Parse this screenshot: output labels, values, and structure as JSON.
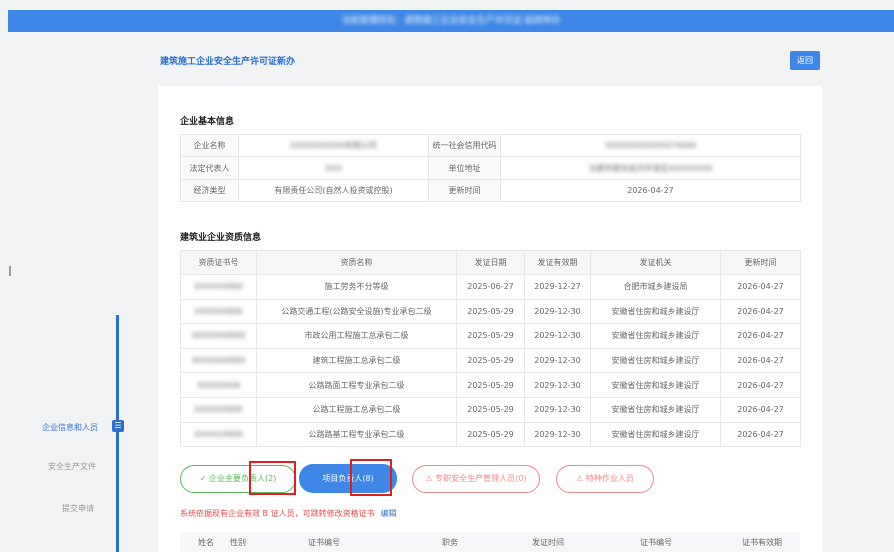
{
  "header": {
    "title": "当前管理所在：建筑施工企业安全生产许可证 延续申办"
  },
  "page": {
    "title": "建筑施工企业安全生产许可证新办",
    "back_label": "返回"
  },
  "sidebar": {
    "steps": [
      "企业信息和人员",
      "安全生产文件",
      "提交申请"
    ]
  },
  "basic_info": {
    "title": "企业基本信息",
    "rows": [
      {
        "k1": "企业名称",
        "v1": "XXXXXXXXXX有限公司",
        "k2": "统一社会信用代码",
        "v2": "XXXXXXXXXXXX74040"
      },
      {
        "k1": "法定代表人",
        "v1": "XXX",
        "k2": "单位地址",
        "v2": "合肥市肥东经济开发区XXXXXXXX"
      },
      {
        "k1": "经济类型",
        "v1": "有限责任公司(自然人投资或控股)",
        "k2": "更新时间",
        "v2": "2026-04-27"
      }
    ]
  },
  "qualification": {
    "title": "建筑业企业资质信息",
    "columns": [
      "资质证书号",
      "资质名称",
      "发证日期",
      "发证有效期",
      "发证机关",
      "更新时间"
    ],
    "rows": [
      [
        "XXXXXX900",
        "施工劳务不分等级",
        "2025-06-27",
        "2029-12-27",
        "合肥市城乡建设局",
        "2026-04-27"
      ],
      [
        "XXXXXX909",
        "公路交通工程(公路安全设施)专业承包二级",
        "2025-05-29",
        "2029-12-30",
        "安徽省住房和城乡建设厅",
        "2026-04-27"
      ],
      [
        "XXXXXX0909",
        "市政公用工程施工总承包二级",
        "2025-05-29",
        "2029-12-30",
        "安徽省住房和城乡建设厅",
        "2026-04-27"
      ],
      [
        "XXXXXX0909",
        "建筑工程施工总承包二级",
        "2025-05-29",
        "2029-12-30",
        "安徽省住房和城乡建设厅",
        "2026-04-27"
      ],
      [
        "XXXXXX09",
        "公路路面工程专业承包二级",
        "2025-05-29",
        "2029-12-30",
        "安徽省住房和城乡建设厅",
        "2026-04-27"
      ],
      [
        "XXXXXX909",
        "公路工程施工总承包二级",
        "2025-05-29",
        "2029-12-30",
        "安徽省住房和城乡建设厅",
        "2026-04-27"
      ],
      [
        "XXXXXX909",
        "公路路基工程专业承包二级",
        "2025-05-29",
        "2029-12-30",
        "安徽省住房和城乡建设厅",
        "2026-04-27"
      ]
    ]
  },
  "actions": {
    "green": "✓ 企业主要负责人(2)",
    "blue": "项目负责人(8)",
    "red1": "⚠ 专职安全生产管理人员(0)",
    "red2": "⚠ 特种作业人员"
  },
  "warning": {
    "text": "系统依据现有企业有效 B 证人员，可跳转修改资格证书",
    "edit": "编辑"
  },
  "bottom_columns": [
    "姓名",
    "性别",
    "证书编号",
    "职务",
    "发证时间",
    "证书编号",
    "证书有效期"
  ],
  "colors": {
    "primary": "#3e87e6",
    "success": "#5cb85c",
    "danger": "#e84c4c",
    "highlight": "#e02020"
  }
}
